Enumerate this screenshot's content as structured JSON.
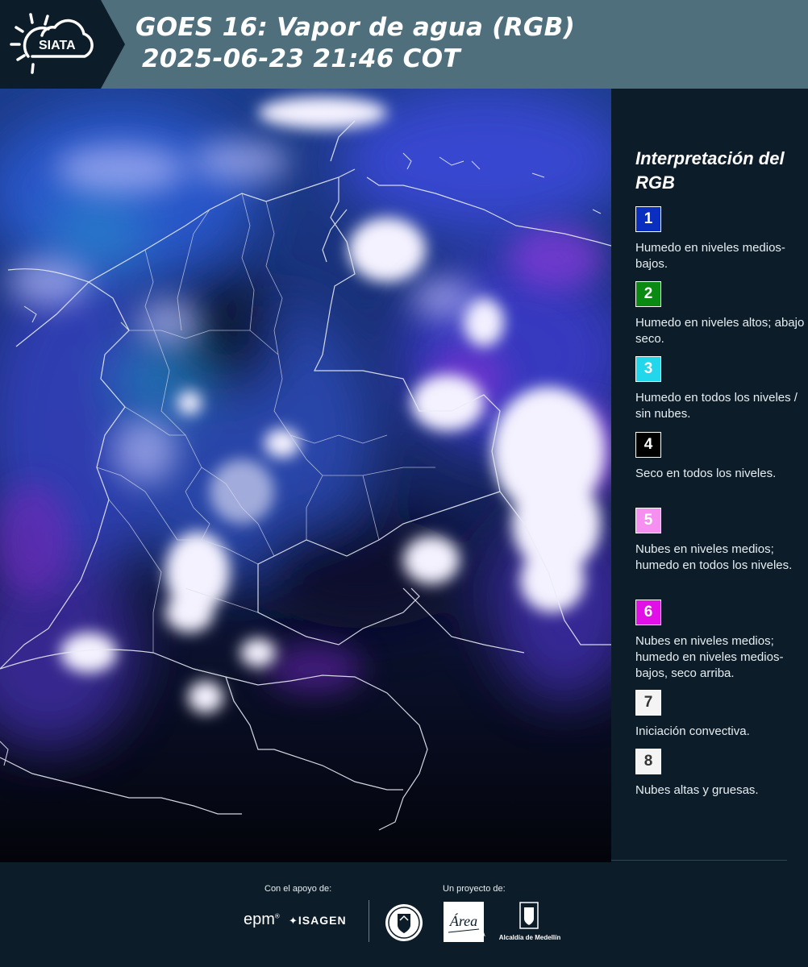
{
  "header": {
    "logo_text": "SIATA",
    "title_line1": "GOES 16: Vapor de agua (RGB)",
    "title_line2": "2025-06-23 21:46 COT"
  },
  "legend": {
    "title": "Interpretación del RGB",
    "items": [
      {
        "number": "1",
        "color": "#0a2fc0",
        "text_color": "#ffffff",
        "description": "Humedo en niveles medios-bajos."
      },
      {
        "number": "2",
        "color": "#0a8a12",
        "text_color": "#ffffff",
        "description": "Humedo en niveles altos; abajo seco."
      },
      {
        "number": "3",
        "color": "#22d6ec",
        "text_color": "#ffffff",
        "description": "Humedo en todos los niveles / sin nubes."
      },
      {
        "number": "4",
        "color": "#000000",
        "text_color": "#ffffff",
        "description": "Seco en todos los niveles."
      },
      {
        "number": "5",
        "color": "#f58ff0",
        "text_color": "#ffffff",
        "description": "Nubes en niveles medios; humedo en todos los niveles."
      },
      {
        "number": "6",
        "color": "#e010e6",
        "text_color": "#ffffff",
        "description": "Nubes en niveles medios; humedo en niveles medios-bajos, seco arriba."
      },
      {
        "number": "7",
        "color": "#f4f4f4",
        "text_color": "#333333",
        "description": "Iniciación convectiva."
      },
      {
        "number": "8",
        "color": "#f4f4f4",
        "text_color": "#333333",
        "description": "Nubes altas y gruesas."
      }
    ]
  },
  "footer": {
    "support_caption": "Con el apoyo de:",
    "project_caption": "Un proyecto de:",
    "sponsor_epm": "epm",
    "sponsor_isagen": "ISAGEN",
    "area_text": "Área",
    "area_caption": "METROPOLITANA",
    "alcaldia_caption": "Alcaldía de Medellín"
  }
}
